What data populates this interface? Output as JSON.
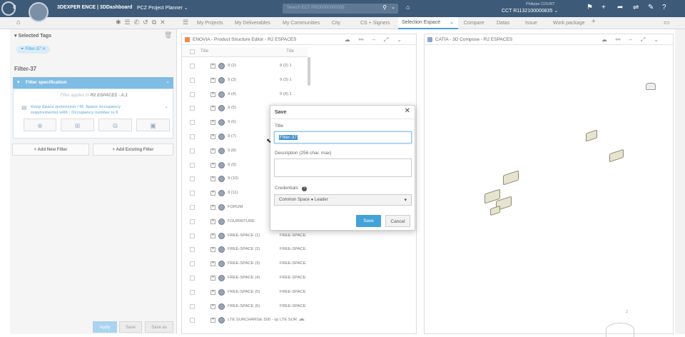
{
  "topbar": {
    "brand": "3DEXPER ENCE | 3DDashboard",
    "dashboard_name": "PCZ Project Planner",
    "search_placeholder": "Search ECT PRO0000000035",
    "user_name": "Philippe COURT",
    "tenant": "CCT R1132100000835"
  },
  "tabs": [
    "My Projects",
    "My Deliverables",
    "My Communities",
    "City",
    "CS + Signers",
    "Selection Espace",
    "Compare",
    "Datas",
    "Issue",
    "Work package"
  ],
  "active_tab": "Selection Espace",
  "left": {
    "selected_tags_label": "Selected Tags",
    "tag_chip": "Filter-37",
    "filter_title": "Filter-37",
    "filter_spec_label": "Filter specification",
    "filter_applies_prefix": "Filter applies to",
    "filter_applies_target": "R2 ESPACES - A.1",
    "keep_space_text": "Keep Space (extension / fil: Space occupancy requirements) with : Occupancy number is 0",
    "add_new_filter": "Add New Filter",
    "add_existing_filter": "Add Existing Filter",
    "apply": "Apply",
    "save": "Save",
    "save_as": "Save as"
  },
  "center": {
    "title": "ENOVIA - Product Structure Editor - R2 ESPACES",
    "col_title": "Title",
    "col_title2": "Title",
    "rows": [
      {
        "name": "9 (2)",
        "title": "9 (2) 1"
      },
      {
        "name": "9 (3)",
        "title": "9 (3) 1"
      },
      {
        "name": "9 (4)",
        "title": "9 (4) 1"
      },
      {
        "name": "9 (5)",
        "title": "9 (5) 1"
      },
      {
        "name": "9 (6)",
        "title": "9 (6) 1"
      },
      {
        "name": "9 (7)",
        "title": "9 (7) 1"
      },
      {
        "name": "9 (8)",
        "title": "9 (8) 1"
      },
      {
        "name": "9 (9)",
        "title": "9 (9) 1"
      },
      {
        "name": "9 (10)",
        "title": "9 (10) 1"
      },
      {
        "name": "9 (11)",
        "title": "9 (11) 1"
      },
      {
        "name": "FORUM",
        "title": "FORUM"
      },
      {
        "name": "FOURNITURE",
        "title": "FOURNITURE"
      },
      {
        "name": "FREE-SPACE (1)",
        "title": "FREE-SPACE"
      },
      {
        "name": "FREE-SPACE (2)",
        "title": "FREE-SPACE"
      },
      {
        "name": "FREE-SPACE (3)",
        "title": "FREE-SPACE"
      },
      {
        "name": "FREE-SPACE (4)",
        "title": "FREE-SPACE"
      },
      {
        "name": "FREE-SPACE (5)",
        "title": "FREE-SPACE"
      },
      {
        "name": "FREE-SPACE (6)",
        "title": "FREE-SPACE"
      },
      {
        "name": "LTE SURCHARGE 500 - sp",
        "title": "LTE SUR"
      }
    ]
  },
  "right": {
    "title": "CATIA - 3D Compose - R2 ESPACES"
  },
  "dialog": {
    "title": "Save",
    "title_label": "Title",
    "title_value": "Filter-37",
    "description_label": "Description (256 char. max)",
    "credentials_label": "Credentials",
    "credentials_value": "Common Space ● Leader",
    "save": "Save",
    "cancel": "Cancel"
  },
  "colors": {
    "topbar": "#3d5a78",
    "accent": "#42a2da",
    "enovia_icon": "#f08a4b",
    "catia_icon": "#8aa3d8"
  }
}
